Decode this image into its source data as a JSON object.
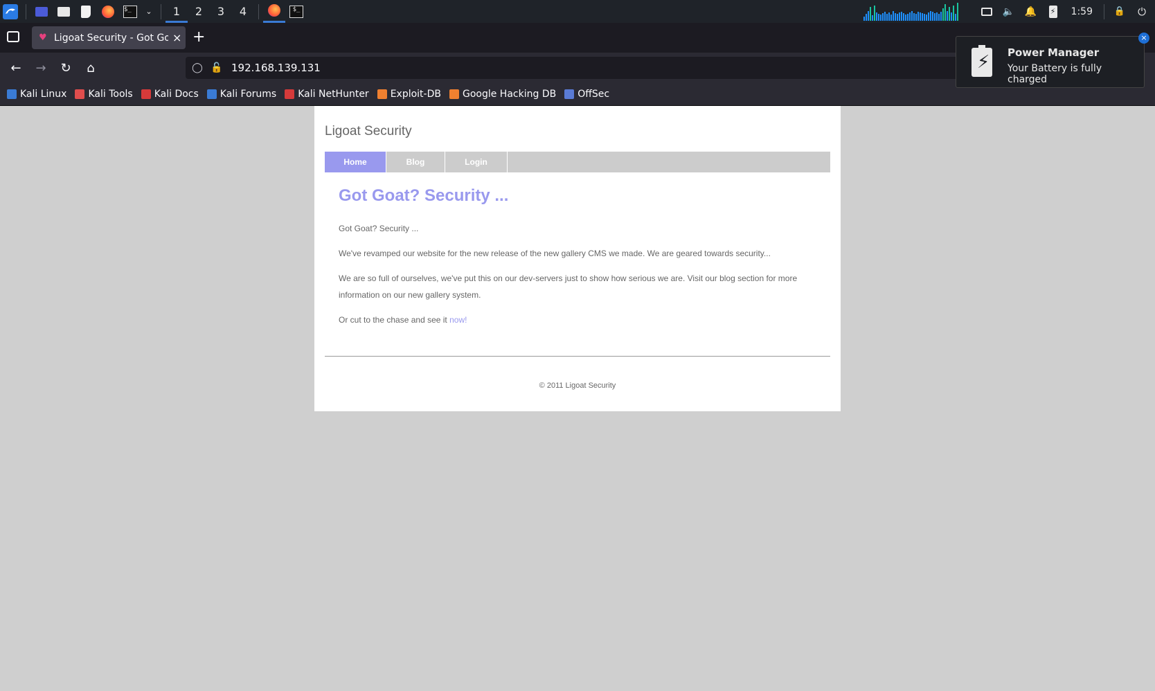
{
  "taskbar": {
    "workspaces": [
      "1",
      "2",
      "3",
      "4"
    ],
    "clock": "1:59",
    "icons": [
      "kali-menu-icon",
      "desktop-icon",
      "file-manager-icon",
      "text-editor-icon",
      "firefox-icon",
      "terminal-icon",
      "chevron-down-icon",
      "network-icon",
      "volume-icon",
      "bell-icon",
      "battery-icon",
      "lock-icon",
      "power-icon"
    ]
  },
  "browser": {
    "tab_title": "Ligoat Security - Got Goat? Security ...",
    "url": "192.168.139.131"
  },
  "bookmarks": [
    {
      "label": "Kali Linux",
      "color": "#3a7bd5"
    },
    {
      "label": "Kali Tools",
      "color": "#e04d4d"
    },
    {
      "label": "Kali Docs",
      "color": "#d63a3a"
    },
    {
      "label": "Kali Forums",
      "color": "#3a7bd5"
    },
    {
      "label": "Kali NetHunter",
      "color": "#d63a3a"
    },
    {
      "label": "Exploit-DB",
      "color": "#f08030"
    },
    {
      "label": "Google Hacking DB",
      "color": "#f08030"
    },
    {
      "label": "OffSec",
      "color": "#5a7bd5"
    }
  ],
  "notification": {
    "title": "Power Manager",
    "body": "Your Battery is fully charged"
  },
  "page": {
    "site_title": "Ligoat Security",
    "menu": [
      "Home",
      "Blog",
      "Login"
    ],
    "heading": "Got Goat? Security ...",
    "p1": "Got Goat? Security ...",
    "p2": "We've revamped our website for the new release of the new gallery CMS we made. We are geared towards security...",
    "p3": "We are so full of ourselves, we've put this on our dev-servers just to show how serious we are. Visit our blog section for more information on our new gallery system.",
    "p4_prefix": "Or cut to the chase and see it ",
    "p4_link": "now!",
    "footer": "© 2011 Ligoat Security"
  },
  "colors": {
    "accent": "#9999ee",
    "menu_bg": "#cccccc"
  }
}
